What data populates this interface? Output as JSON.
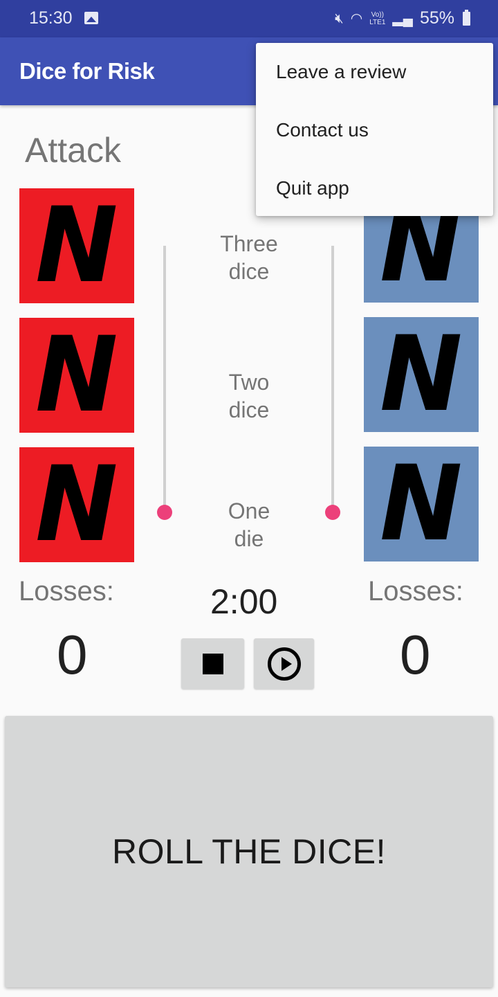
{
  "status_bar": {
    "time": "15:30",
    "battery": "55%",
    "network_label_top": "Vo))",
    "network_label_bottom": "LTE1",
    "icons": [
      "image-icon",
      "mute-icon",
      "wifi-icon",
      "volte-icon",
      "signal-icon",
      "battery-icon"
    ]
  },
  "app_bar": {
    "title": "Dice for Risk"
  },
  "attack": {
    "label": "Attack",
    "dice": [
      "N",
      "N",
      "N"
    ],
    "color": "#ed1c24",
    "losses_label": "Losses:",
    "losses": "0",
    "slider_value": "One die"
  },
  "defense": {
    "dice": [
      "N",
      "N",
      "N"
    ],
    "color": "#6b8fbd",
    "losses_label": "Losses:",
    "losses": "0",
    "slider_value": "One die"
  },
  "dice_options": [
    {
      "line1": "Three",
      "line2": "dice"
    },
    {
      "line1": "Two",
      "line2": "dice"
    },
    {
      "line1": "One",
      "line2": "die"
    }
  ],
  "timer": {
    "value": "2:00",
    "stop_icon": "stop-icon",
    "play_icon": "play-circle-icon"
  },
  "roll_button": {
    "label": "ROLL THE DICE!"
  },
  "overflow_menu": {
    "items": [
      {
        "label": "Leave a review"
      },
      {
        "label": "Contact us"
      },
      {
        "label": "Quit app"
      }
    ]
  },
  "colors": {
    "status_bar": "#303f9f",
    "app_bar": "#3f51b5",
    "accent": "#ec407a"
  }
}
